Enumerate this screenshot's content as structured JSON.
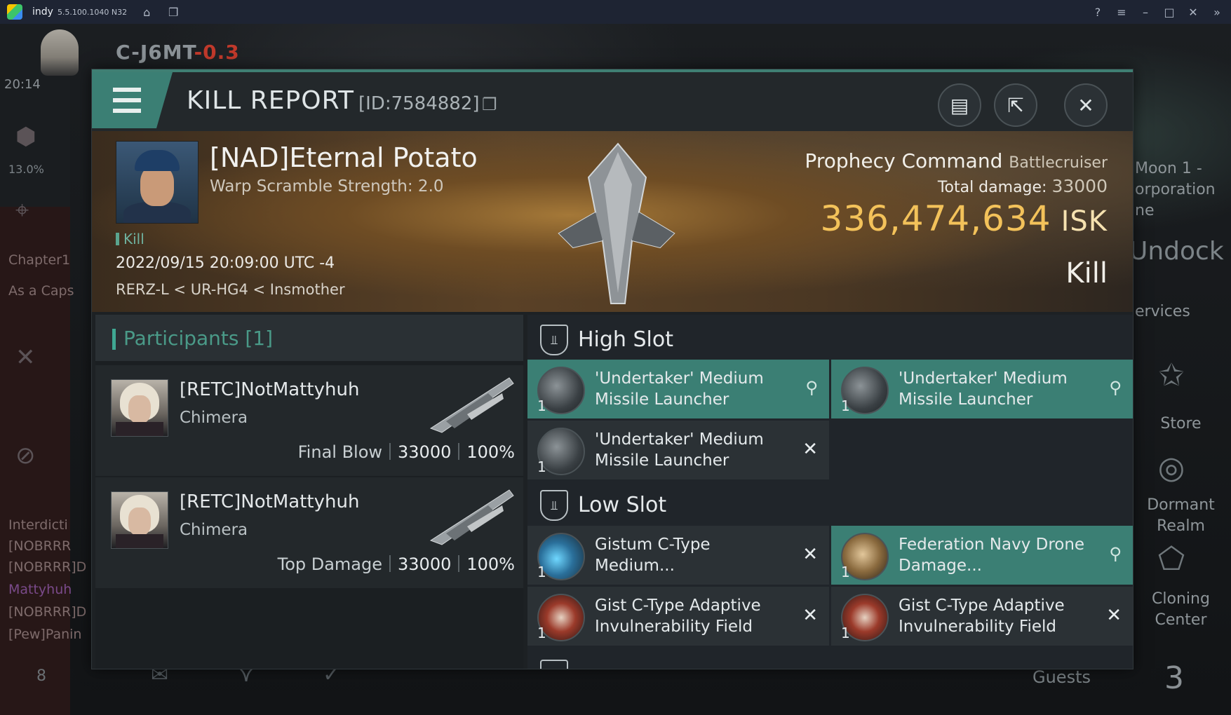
{
  "emulator": {
    "app_name": "indy",
    "version": "5.5.100.1040 N32"
  },
  "hud": {
    "system_name": "C-J6MT",
    "security": "-0.3",
    "clock": "20:14",
    "percent": "13.0%",
    "left_texts": [
      "Chapter1",
      "As a Caps",
      "Interdicti",
      "[NOBRRR",
      "[NOBRRR]D",
      "Mattyhuh",
      "[NOBRRR]D",
      "[Pew]Panin"
    ],
    "right_texts": [
      "Moon 1 -",
      "orporation",
      "ne"
    ],
    "undock": "Undock",
    "services": "ervices",
    "store": "Store",
    "dormant_realm": [
      "Dormant",
      "Realm"
    ],
    "cloning_center": [
      "Cloning",
      "Center"
    ],
    "guests": "Guests",
    "guests_count": "3",
    "bottom_number": "8"
  },
  "window": {
    "title": "KILL REPORT",
    "report_id": "[ID:7584882]"
  },
  "victim": {
    "name": "[NAD]Eternal Potato",
    "warp_scramble": "Warp Scramble Strength: 2.0",
    "kill_tag": "Kill",
    "datetime": "2022/09/15 20:09:00 UTC -4",
    "location": "RERZ-L < UR-HG4 < Insmother",
    "ship_name": "Prophecy Command",
    "ship_class": "Battlecruiser",
    "total_damage_label": "Total damage:",
    "total_damage": "33000",
    "isk_value": "336,474,634",
    "isk_unit": "ISK",
    "kill_type": "Kill"
  },
  "participants": {
    "title": "Participants [1]",
    "rows": [
      {
        "name": "[RETC]NotMattyhuh",
        "ship": "Chimera",
        "role": "Final Blow",
        "damage": "33000",
        "percent": "100%"
      },
      {
        "name": "[RETC]NotMattyhuh",
        "ship": "Chimera",
        "role": "Top Damage",
        "damage": "33000",
        "percent": "100%"
      }
    ]
  },
  "fitting": {
    "high_slot_label": "High Slot",
    "low_slot_label": "Low Slot",
    "high": [
      {
        "qty": "1",
        "name": "'Undertaker' Medium Missile Launcher",
        "status": "dropped"
      },
      {
        "qty": "1",
        "name": "'Undertaker' Medium Missile Launcher",
        "status": "dropped"
      },
      {
        "qty": "1",
        "name": "'Undertaker' Medium Missile Launcher",
        "status": "destroyed"
      }
    ],
    "low": [
      {
        "qty": "1",
        "name": "Gistum C-Type Medium...",
        "status": "destroyed"
      },
      {
        "qty": "1",
        "name": "Federation Navy Drone Damage...",
        "status": "dropped"
      },
      {
        "qty": "1",
        "name": "Gist C-Type Adaptive Invulnerability Field",
        "status": "destroyed"
      },
      {
        "qty": "1",
        "name": "Gist C-Type Adaptive Invulnerability Field",
        "status": "destroyed"
      }
    ],
    "colors": {
      "dropped": "#3b7f74",
      "destroyed": "#2b3135",
      "accent": "#3fa893"
    }
  },
  "icons": {
    "menu": "hamburger-icon",
    "copy": "copy-icon",
    "clipboard": "clipboard-icon",
    "share": "share-icon",
    "close": "close-icon",
    "slot": "slot-shield-icon",
    "dropped": "person-icon",
    "destroyed": "x-icon"
  }
}
